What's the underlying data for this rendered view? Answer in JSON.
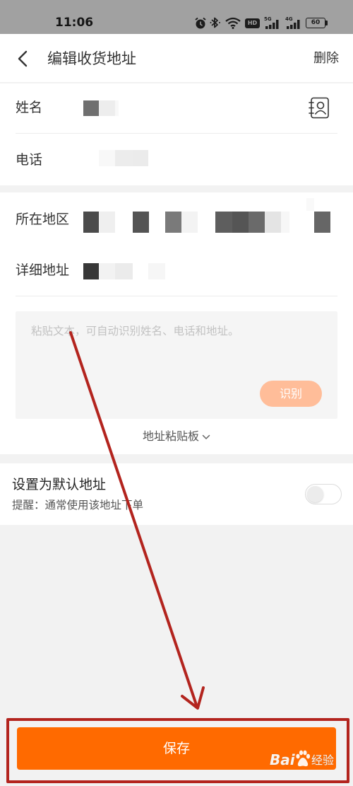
{
  "status_bar": {
    "time": "11:06",
    "hd_badge": "HD",
    "signal_1_label": "5G",
    "signal_2_label": "4G",
    "battery": "60",
    "icons": [
      "alarm-icon",
      "bluetooth-icon",
      "wifi-icon",
      "hd-icon",
      "signal-icon",
      "signal-icon",
      "battery-icon"
    ]
  },
  "header": {
    "back_icon": "chevron-left-icon",
    "title": "编辑收货地址",
    "delete_label": "删除"
  },
  "form": {
    "name_label": "姓名",
    "phone_label": "电话",
    "region_label": "所在地区",
    "detail_label": "详细地址",
    "contact_icon": "contact-book-icon"
  },
  "paste": {
    "placeholder": "粘贴文本，可自动识别姓名、电话和地址。",
    "recognize_label": "识别",
    "clipboard_label": "地址粘贴板",
    "clipboard_icon": "chevron-down-icon"
  },
  "default_address": {
    "title": "设置为默认地址",
    "hint": "提醒：通常使用该地址下单",
    "enabled": false
  },
  "save_label": "保存",
  "watermark": {
    "text_1": "Bai",
    "text_2": "经验",
    "icon": "paw-icon"
  },
  "colors": {
    "accent": "#ff6a00",
    "recognize_button": "#ffbd99",
    "annotation": "#b3241e",
    "page_background": "#f2f2f2"
  }
}
